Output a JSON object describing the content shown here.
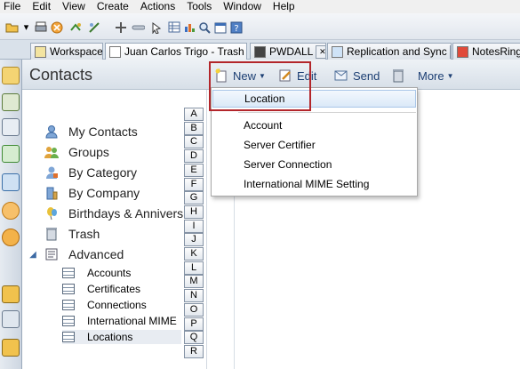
{
  "menubar": [
    "File",
    "Edit",
    "View",
    "Create",
    "Actions",
    "Tools",
    "Window",
    "Help"
  ],
  "tabs": [
    {
      "label": "Workspace"
    },
    {
      "label": "Juan Carlos Trigo - Trash"
    },
    {
      "label": "PWDALL"
    },
    {
      "label": "Replication and Sync"
    },
    {
      "label": "NotesRing."
    }
  ],
  "header": {
    "title": "Contacts",
    "new_label": "New",
    "edit_label": "Edit",
    "send_label": "Send",
    "more_label": "More"
  },
  "nav": {
    "items": [
      "My Contacts",
      "Groups",
      "By Category",
      "By Company",
      "Birthdays & Annivers",
      "Trash",
      "Advanced"
    ],
    "subitems": [
      "Accounts",
      "Certificates",
      "Connections",
      "International MIME",
      "Locations"
    ]
  },
  "alphabet": [
    "A",
    "B",
    "C",
    "D",
    "E",
    "F",
    "G",
    "H",
    "I",
    "J",
    "K",
    "L",
    "M",
    "N",
    "O",
    "P",
    "Q",
    "R"
  ],
  "new_menu": {
    "items": [
      "Location",
      "Account",
      "Server Certifier",
      "Server Connection",
      "International MIME Setting"
    ]
  },
  "colors": {
    "highlight_box": "#b3262b",
    "link_text": "#1c3f73",
    "menu_highlight": "#dbe9f8"
  }
}
